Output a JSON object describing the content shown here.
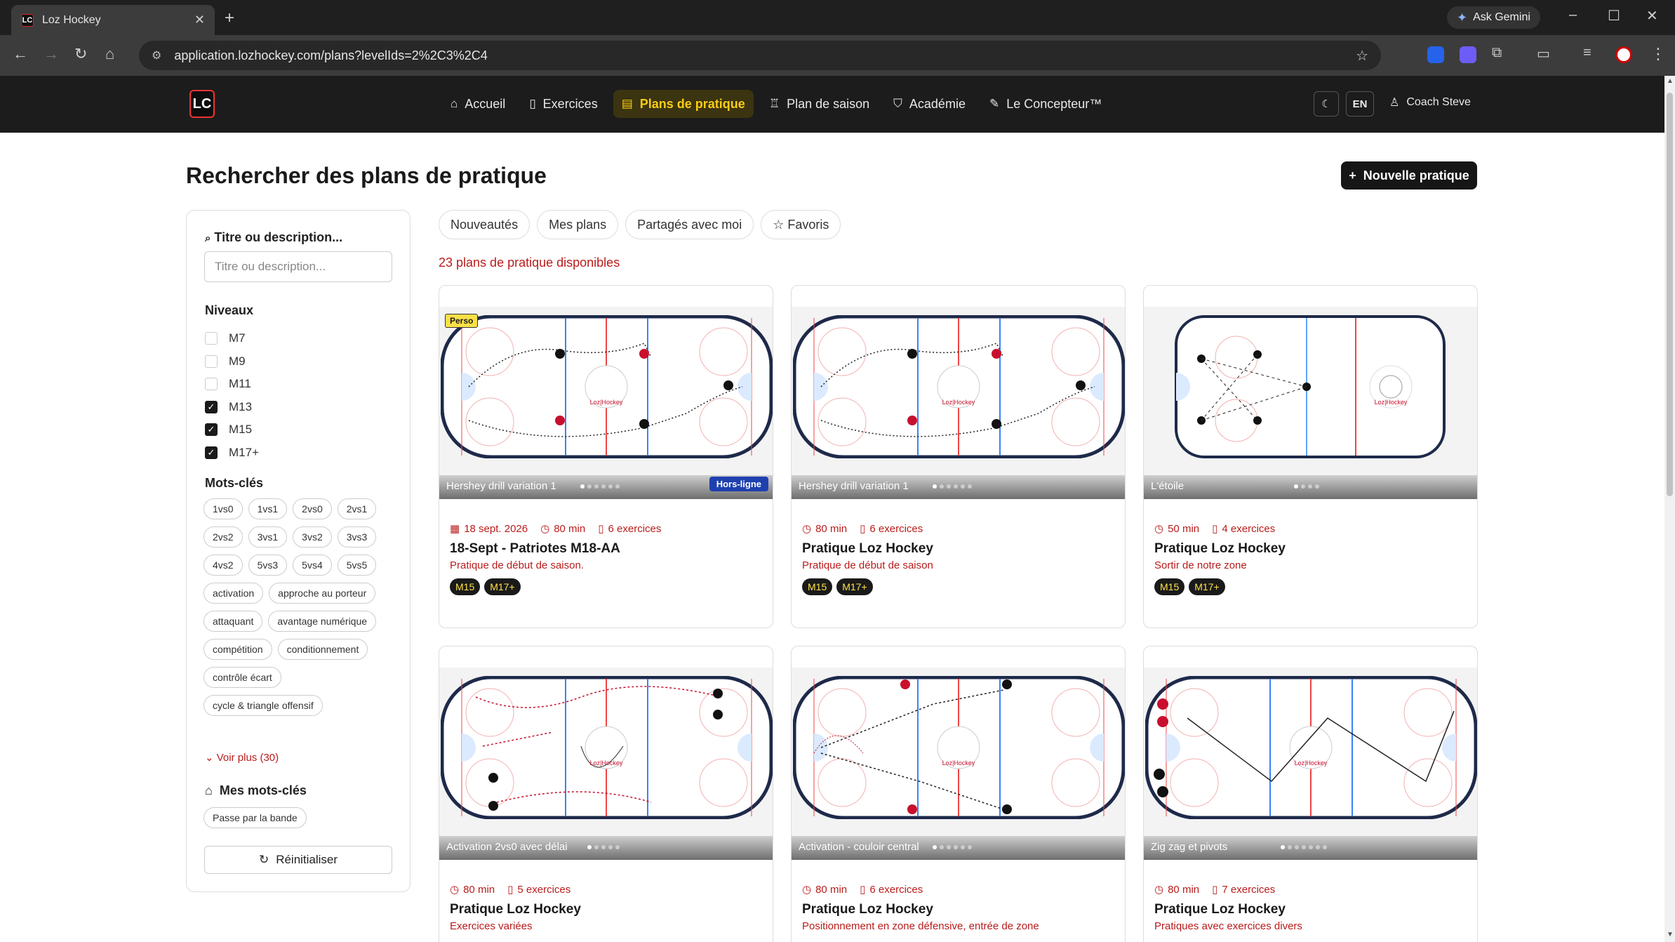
{
  "browser": {
    "tab_title": "Loz Hockey",
    "tab_favicon_text": "LC",
    "gemini_label": "Ask Gemini",
    "url": "application.lozhockey.com/plans?levelIds=2%2C3%2C4"
  },
  "header": {
    "logo_text": "LC",
    "nav": [
      {
        "label": "Accueil",
        "icon": "home-icon"
      },
      {
        "label": "Exercices",
        "icon": "book-icon"
      },
      {
        "label": "Plans de pratique",
        "icon": "clipboard-icon"
      },
      {
        "label": "Plan de saison",
        "icon": "trophy-icon"
      },
      {
        "label": "Académie",
        "icon": "graduation-cap-icon"
      },
      {
        "label": "Le Concepteur™",
        "icon": "pencil-icon"
      }
    ],
    "lang": "EN",
    "user": "Coach Steve"
  },
  "page": {
    "title": "Rechercher des plans de pratique",
    "new_button": "Nouvelle pratique",
    "count": "23 plans de pratique disponibles"
  },
  "sidebar": {
    "search_label": "Titre ou description...",
    "search_placeholder": "Titre ou description...",
    "levels_label": "Niveaux",
    "levels": [
      {
        "label": "M7",
        "checked": false
      },
      {
        "label": "M9",
        "checked": false
      },
      {
        "label": "M11",
        "checked": false
      },
      {
        "label": "M13",
        "checked": true
      },
      {
        "label": "M15",
        "checked": true
      },
      {
        "label": "M17+",
        "checked": true
      }
    ],
    "keywords_label": "Mots-clés",
    "keywords": [
      "1vs0",
      "1vs1",
      "2vs0",
      "2vs1",
      "2vs2",
      "3vs1",
      "3vs2",
      "3vs3",
      "4vs2",
      "5vs3",
      "5vs4",
      "5vs5",
      "activation",
      "approche au porteur",
      "attaquant",
      "avantage numérique",
      "compétition",
      "conditionnement",
      "contrôle écart",
      "cycle & triangle offensif"
    ],
    "see_more": "Voir plus (30)",
    "my_keywords_label": "Mes mots-clés",
    "my_keywords": [
      "Passe par la bande"
    ],
    "reset": "Réinitialiser"
  },
  "filters": [
    "Nouveautés",
    "Mes plans",
    "Partagés avec moi",
    "☆ Favoris"
  ],
  "cards": [
    {
      "caption": "Hershey drill variation 1",
      "date": "18 sept. 2026",
      "duration": "80 min",
      "exercises": "6 exercices",
      "title": "18-Sept - Patriotes M18-AA",
      "desc": "Pratique de début de saison.",
      "tags": [
        "M15",
        "M17+"
      ],
      "perso": "Perso",
      "offline": "Hors-ligne",
      "dots": 6
    },
    {
      "caption": "Hershey drill variation 1",
      "date": "",
      "duration": "80 min",
      "exercises": "6 exercices",
      "title": "Pratique Loz Hockey",
      "desc": "Pratique de début de saison",
      "tags": [
        "M15",
        "M17+"
      ],
      "dots": 6
    },
    {
      "caption": "L'étoile",
      "date": "",
      "duration": "50 min",
      "exercises": "4 exercices",
      "title": "Pratique Loz Hockey",
      "desc": "Sortir de notre zone",
      "tags": [
        "M15",
        "M17+"
      ],
      "dots": 4
    },
    {
      "caption": "Activation 2vs0 avec délai",
      "date": "",
      "duration": "80 min",
      "exercises": "5 exercices",
      "title": "Pratique Loz Hockey",
      "desc": "Exercices variées",
      "tags": [],
      "dots": 5
    },
    {
      "caption": "Activation - couloir central",
      "date": "",
      "duration": "80 min",
      "exercises": "6 exercices",
      "title": "Pratique Loz Hockey",
      "desc": "Positionnement en zone défensive, entrée de zone",
      "tags": [],
      "dots": 6
    },
    {
      "caption": "Zig zag et pivots",
      "date": "",
      "duration": "80 min",
      "exercises": "7 exercices",
      "title": "Pratique Loz Hockey",
      "desc": "Pratiques avec exercices divers",
      "tags": [],
      "dots": 7
    }
  ],
  "rink_logo_text": "Loz|Hockey",
  "colors": {
    "accent": "#facc15",
    "red": "#b91c1c",
    "dark": "#1c1c1c"
  }
}
